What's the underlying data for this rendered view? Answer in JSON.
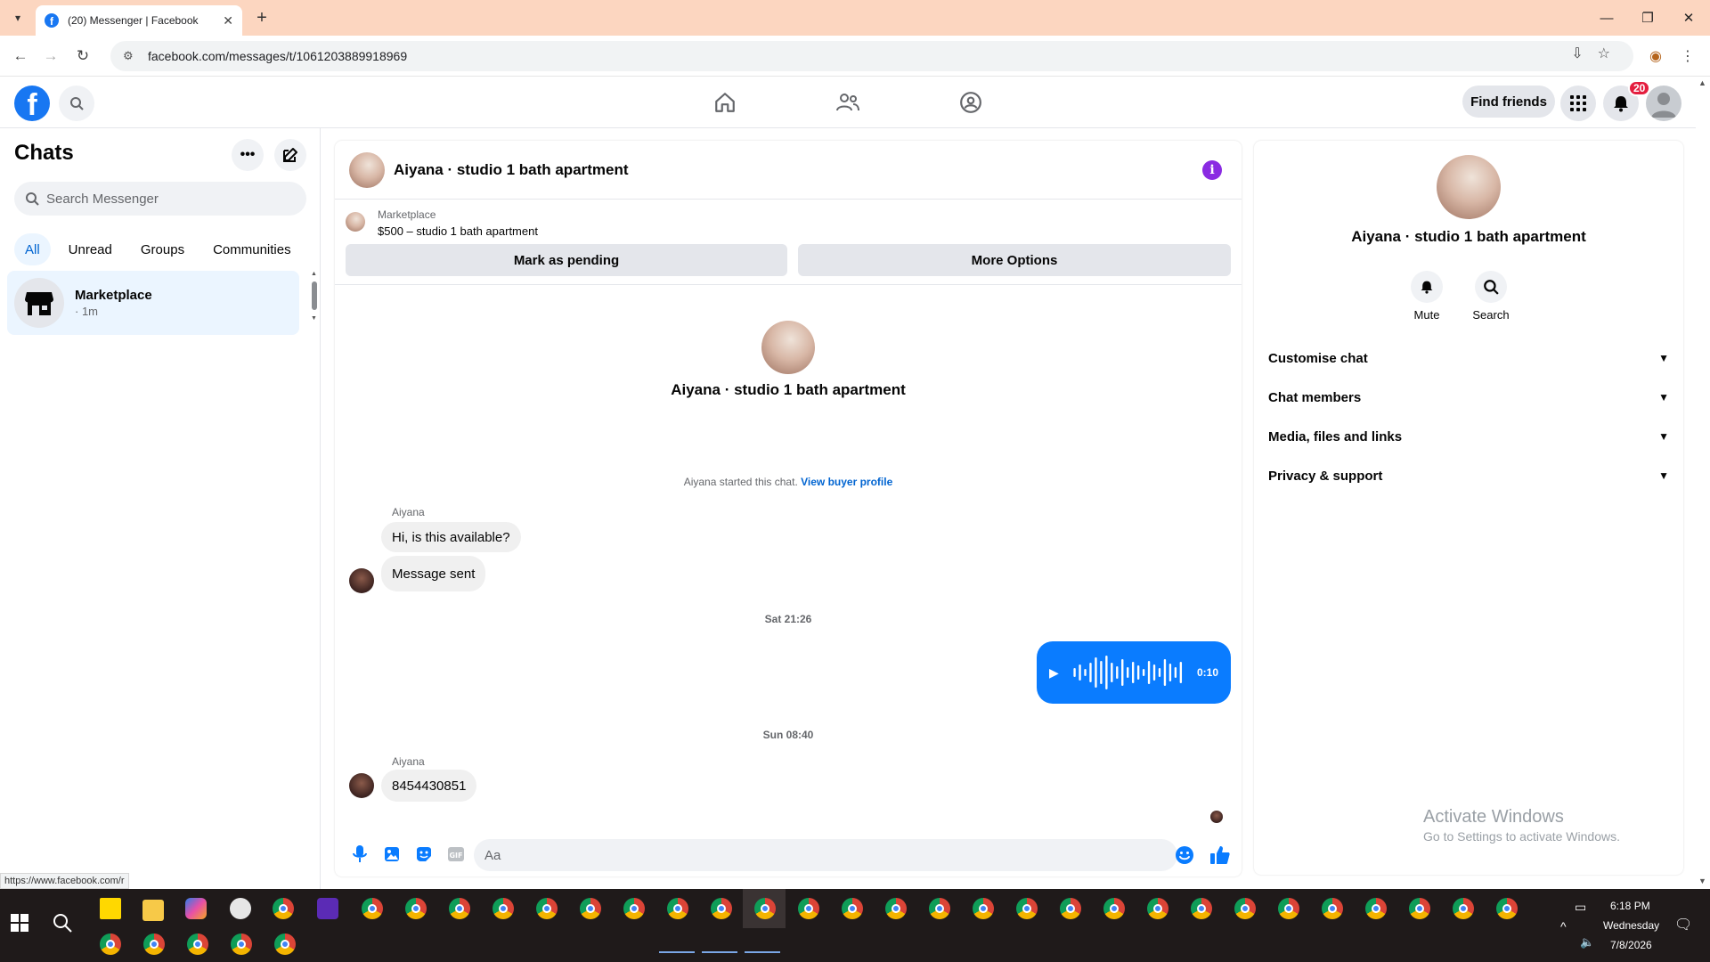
{
  "browser": {
    "tab_title": "(20) Messenger | Facebook",
    "url": "facebook.com/messages/t/1061203889918969",
    "status_url": "https://www.facebook.com/r"
  },
  "header": {
    "find_friends": "Find friends",
    "notification_count": "20"
  },
  "sidebar": {
    "title": "Chats",
    "search_placeholder": "Search Messenger",
    "filters": [
      "All",
      "Unread",
      "Groups",
      "Communities"
    ],
    "chats": [
      {
        "name": "Marketplace",
        "time": "· 1m"
      }
    ]
  },
  "conversation": {
    "title": "Aiyana · studio 1 bath apartment",
    "marketplace_label": "Marketplace",
    "listing": "$500 – studio 1 bath apartment",
    "mark_pending": "Mark as pending",
    "more_options": "More Options",
    "intro_name": "Aiyana · studio 1 bath apartment",
    "started_text": "Aiyana started this chat.",
    "view_buyer": "View buyer profile",
    "messages": [
      {
        "sender": "Aiyana",
        "text": "Hi, is this available?"
      },
      {
        "text": "Message sent"
      }
    ],
    "time_1": "Sat 21:26",
    "voice_duration": "0:10",
    "time_2": "Sun 08:40",
    "message_3_sender": "Aiyana",
    "message_3_text": "8454430851",
    "composer_placeholder": "Aa"
  },
  "info_panel": {
    "name": "Aiyana · studio 1 bath apartment",
    "mute_label": "Mute",
    "search_label": "Search",
    "rows": [
      "Customise chat",
      "Chat members",
      "Media, files and links",
      "Privacy & support"
    ]
  },
  "watermark": {
    "line1": "Activate Windows",
    "line2": "Go to Settings to activate Windows."
  },
  "taskbar": {
    "time": "6:18 PM",
    "day": "Wednesday",
    "date": "7/8/2026"
  },
  "colors": {
    "fb_blue": "#1877f2",
    "messenger_blue": "#0a7cff",
    "badge_red": "#e41e3f"
  }
}
